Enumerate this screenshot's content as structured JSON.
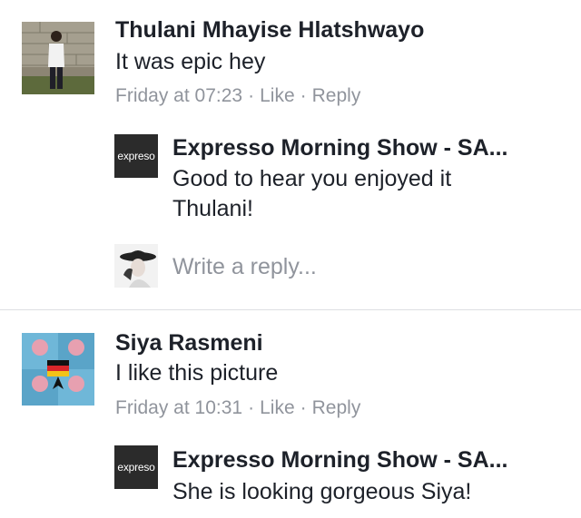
{
  "comments": [
    {
      "author": "Thulani Mhayise Hlatshwayo",
      "text": "It was epic hey",
      "time": "Friday at 07:23",
      "like_label": "Like",
      "reply_label": "Reply",
      "reply": {
        "author": "Expresso Morning Show - SA...",
        "text": "Good to hear you enjoyed it Thulani!",
        "logo_text": "expreso"
      },
      "write_reply_placeholder": "Write a reply..."
    },
    {
      "author": "Siya Rasmeni",
      "text": "I like this picture",
      "time": "Friday at 10:31",
      "like_label": "Like",
      "reply_label": "Reply",
      "reply": {
        "author": "Expresso Morning Show - SA...",
        "text": "She is looking gorgeous Siya!",
        "logo_text": "expreso"
      }
    }
  ],
  "separator": "·",
  "colors": {
    "text": "#1d2129",
    "meta": "#90949c",
    "divider": "#dddfe2"
  }
}
